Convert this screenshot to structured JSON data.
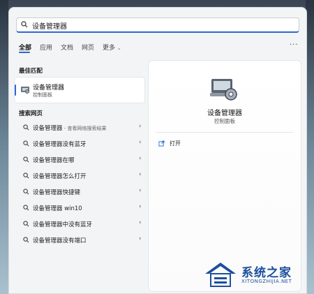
{
  "search": {
    "value": "设备管理器"
  },
  "tabs": [
    {
      "label": "全部",
      "active": true
    },
    {
      "label": "应用"
    },
    {
      "label": "文档"
    },
    {
      "label": "网页"
    },
    {
      "label": "更多"
    }
  ],
  "more_menu": "···",
  "best_match": {
    "heading": "最佳匹配",
    "name": "设备管理器",
    "subtitle": "控制面板"
  },
  "web_search": {
    "heading": "搜索网页",
    "items": [
      {
        "text": "设备管理器",
        "suffix": " - 查看网络搜索结果"
      },
      {
        "text": "设备管理器没有蓝牙"
      },
      {
        "text": "设备管理器在哪"
      },
      {
        "text": "设备管理器怎么打开"
      },
      {
        "text": "设备管理器快捷键"
      },
      {
        "text": "设备管理器 win10"
      },
      {
        "text": "设备管理器中没有蓝牙"
      },
      {
        "text": "设备管理器没有端口"
      }
    ]
  },
  "preview": {
    "name": "设备管理器",
    "subtitle": "控制面板",
    "open_label": "打开"
  },
  "watermark": {
    "text": "系统之家",
    "url": "XITONGZHIJIA.NET"
  },
  "colors": {
    "accent": "#2b68d8",
    "brand": "#1c4f9c"
  },
  "icons": [
    "search-icon",
    "device-manager-icon",
    "chevron-right-icon",
    "open-external-icon",
    "chevron-down-icon"
  ]
}
